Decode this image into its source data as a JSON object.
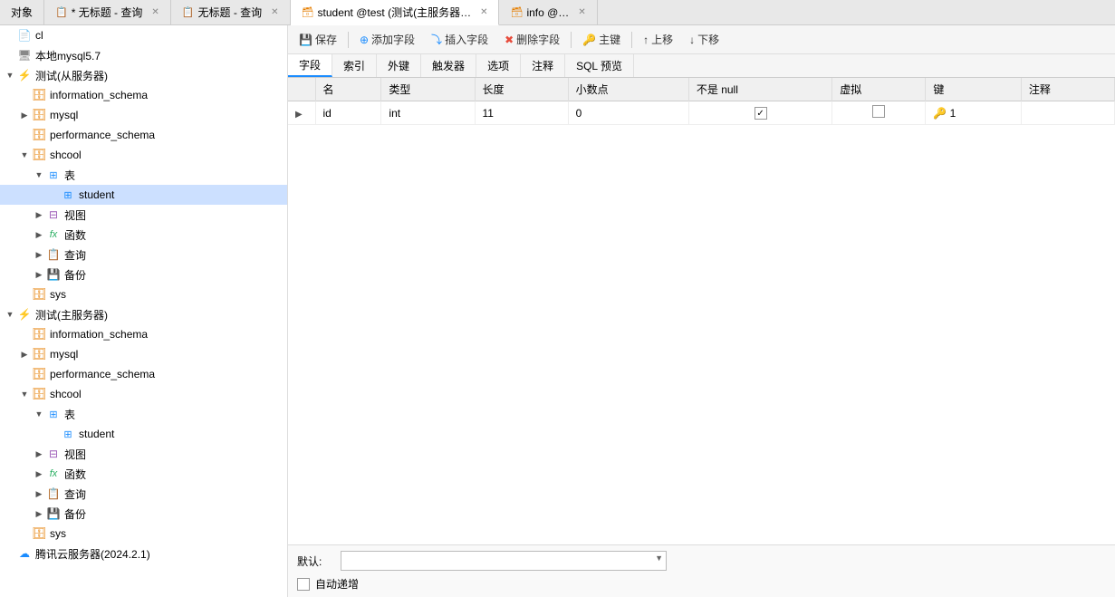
{
  "tabs": [
    {
      "id": "tab-obj",
      "label": "对象",
      "icon": "🗂",
      "active": false,
      "closeable": false
    },
    {
      "id": "tab-query1",
      "label": "* 无标题 - 查询",
      "icon": "📄",
      "active": false,
      "closeable": true
    },
    {
      "id": "tab-query2",
      "label": "无标题 - 查询",
      "icon": "📄",
      "active": false,
      "closeable": true
    },
    {
      "id": "tab-student",
      "label": "student @test (测试(主服务器…",
      "icon": "🗃",
      "active": true,
      "closeable": true
    },
    {
      "id": "tab-info",
      "label": "info @…",
      "icon": "🗃",
      "active": false,
      "closeable": true
    }
  ],
  "toolbar": {
    "save_label": "保存",
    "add_field_label": "添加字段",
    "insert_field_label": "插入字段",
    "delete_field_label": "删除字段",
    "primary_key_label": "主键",
    "move_up_label": "上移",
    "move_down_label": "下移"
  },
  "sub_tabs": [
    {
      "id": "fields",
      "label": "字段",
      "active": true
    },
    {
      "id": "indexes",
      "label": "索引",
      "active": false
    },
    {
      "id": "foreign",
      "label": "外键",
      "active": false
    },
    {
      "id": "triggers",
      "label": "触发器",
      "active": false
    },
    {
      "id": "options",
      "label": "选项",
      "active": false
    },
    {
      "id": "comment",
      "label": "注释",
      "active": false
    },
    {
      "id": "sql_preview",
      "label": "SQL 预览",
      "active": false
    }
  ],
  "table_columns": [
    "名",
    "类型",
    "长度",
    "小数点",
    "不是 null",
    "虚拟",
    "键",
    "注释"
  ],
  "table_rows": [
    {
      "arrow": true,
      "name": "id",
      "type": "int",
      "length": "11",
      "decimal": "0",
      "not_null": true,
      "virtual": false,
      "key": "1",
      "comment": ""
    }
  ],
  "bottom": {
    "default_label": "默认:",
    "autoincrement_label": "自动递增",
    "default_value": ""
  },
  "sidebar": {
    "items": [
      {
        "id": "cl",
        "level": 0,
        "label": "cl",
        "type": "file",
        "expanded": false,
        "indent": 0
      },
      {
        "id": "local-mysql",
        "level": 0,
        "label": "本地mysql5.7",
        "type": "server",
        "expanded": false,
        "indent": 0
      },
      {
        "id": "test-slave",
        "level": 0,
        "label": "测试(从服务器)",
        "type": "server-slave",
        "expanded": true,
        "indent": 0
      },
      {
        "id": "information_schema1",
        "level": 1,
        "label": "information_schema",
        "type": "db",
        "expanded": false,
        "indent": 1
      },
      {
        "id": "mysql1",
        "level": 1,
        "label": "mysql",
        "type": "db",
        "expanded": false,
        "indent": 1
      },
      {
        "id": "performance_schema1",
        "level": 1,
        "label": "performance_schema",
        "type": "db",
        "expanded": false,
        "indent": 1
      },
      {
        "id": "shcool1",
        "level": 1,
        "label": "shcool",
        "type": "db",
        "expanded": true,
        "indent": 1
      },
      {
        "id": "tables1",
        "level": 2,
        "label": "表",
        "type": "table-group",
        "expanded": true,
        "indent": 2
      },
      {
        "id": "student1",
        "level": 3,
        "label": "student",
        "type": "table",
        "expanded": false,
        "indent": 3,
        "selected": true
      },
      {
        "id": "views1",
        "level": 2,
        "label": "视图",
        "type": "view-group",
        "expanded": false,
        "indent": 2
      },
      {
        "id": "funcs1",
        "level": 2,
        "label": "函数",
        "type": "func-group",
        "expanded": false,
        "indent": 2
      },
      {
        "id": "queries1",
        "level": 2,
        "label": "查询",
        "type": "query-group",
        "expanded": false,
        "indent": 2
      },
      {
        "id": "backups1",
        "level": 2,
        "label": "备份",
        "type": "backup-group",
        "expanded": false,
        "indent": 2
      },
      {
        "id": "sys1",
        "level": 1,
        "label": "sys",
        "type": "db",
        "expanded": false,
        "indent": 1
      },
      {
        "id": "test-master",
        "level": 0,
        "label": "测试(主服务器)",
        "type": "server-master",
        "expanded": true,
        "indent": 0
      },
      {
        "id": "information_schema2",
        "level": 1,
        "label": "information_schema",
        "type": "db",
        "expanded": false,
        "indent": 1
      },
      {
        "id": "mysql2",
        "level": 1,
        "label": "mysql",
        "type": "db",
        "expanded": false,
        "indent": 1
      },
      {
        "id": "performance_schema2",
        "level": 1,
        "label": "performance_schema",
        "type": "db",
        "expanded": false,
        "indent": 1
      },
      {
        "id": "shcool2",
        "level": 1,
        "label": "shcool",
        "type": "db",
        "expanded": true,
        "indent": 1
      },
      {
        "id": "tables2",
        "level": 2,
        "label": "表",
        "type": "table-group",
        "expanded": true,
        "indent": 2
      },
      {
        "id": "student2",
        "level": 3,
        "label": "student",
        "type": "table",
        "expanded": false,
        "indent": 3
      },
      {
        "id": "views2",
        "level": 2,
        "label": "视图",
        "type": "view-group",
        "expanded": false,
        "indent": 2
      },
      {
        "id": "funcs2",
        "level": 2,
        "label": "函数",
        "type": "func-group",
        "expanded": false,
        "indent": 2
      },
      {
        "id": "queries2",
        "level": 2,
        "label": "查询",
        "type": "query-group",
        "expanded": false,
        "indent": 2
      },
      {
        "id": "backups2",
        "level": 2,
        "label": "备份",
        "type": "backup-group",
        "expanded": false,
        "indent": 2
      },
      {
        "id": "sys2",
        "level": 1,
        "label": "sys",
        "type": "db",
        "expanded": false,
        "indent": 1
      },
      {
        "id": "tencent",
        "level": 0,
        "label": "腾讯云服务器(2024.2.1)",
        "type": "cloud",
        "expanded": false,
        "indent": 0
      }
    ]
  }
}
